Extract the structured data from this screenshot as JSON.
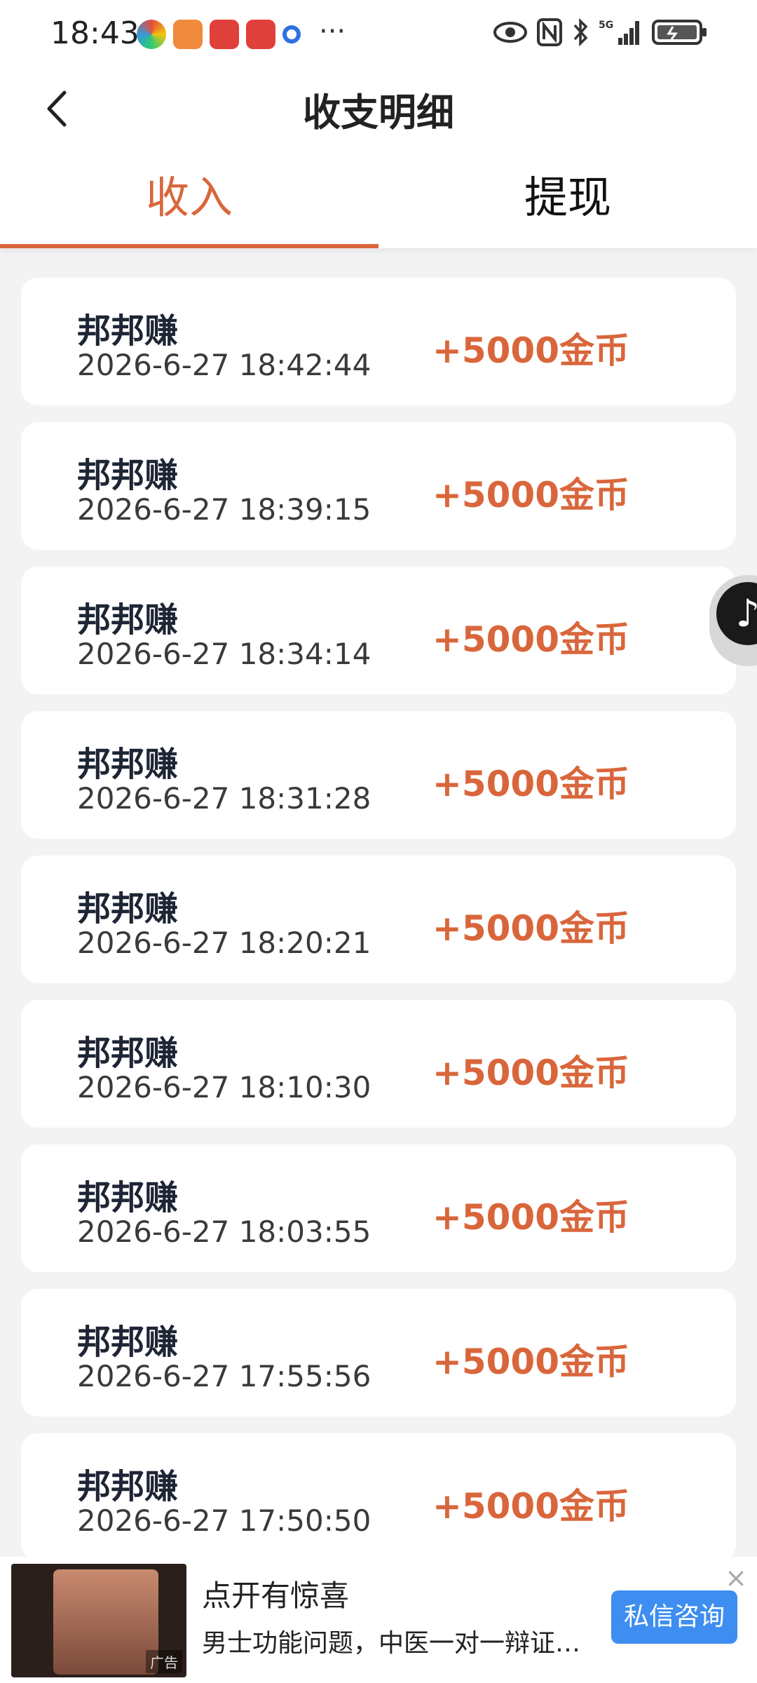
{
  "status_bar": {
    "time": "18:43"
  },
  "header": {
    "title": "收支明细"
  },
  "tabs": [
    {
      "label": "收入",
      "active": true
    },
    {
      "label": "提现",
      "active": false
    }
  ],
  "records": [
    {
      "name": "邦邦赚",
      "time": "2026-6-27 18:42:44",
      "amount": "+5000金币"
    },
    {
      "name": "邦邦赚",
      "time": "2026-6-27 18:39:15",
      "amount": "+5000金币"
    },
    {
      "name": "邦邦赚",
      "time": "2026-6-27 18:34:14",
      "amount": "+5000金币"
    },
    {
      "name": "邦邦赚",
      "time": "2026-6-27 18:31:28",
      "amount": "+5000金币"
    },
    {
      "name": "邦邦赚",
      "time": "2026-6-27 18:20:21",
      "amount": "+5000金币"
    },
    {
      "name": "邦邦赚",
      "time": "2026-6-27 18:10:30",
      "amount": "+5000金币"
    },
    {
      "name": "邦邦赚",
      "time": "2026-6-27 18:03:55",
      "amount": "+5000金币"
    },
    {
      "name": "邦邦赚",
      "time": "2026-6-27 17:55:56",
      "amount": "+5000金币"
    },
    {
      "name": "邦邦赚",
      "time": "2026-6-27 17:50:50",
      "amount": "+5000金币"
    }
  ],
  "ad": {
    "title": "点开有惊喜",
    "description": "男士功能问题，中医一对一辩证用...",
    "button": "私信咨询",
    "thumb_badge": "广告"
  },
  "colors": {
    "accent": "#d9663b",
    "ad_button": "#3d8ef0"
  }
}
